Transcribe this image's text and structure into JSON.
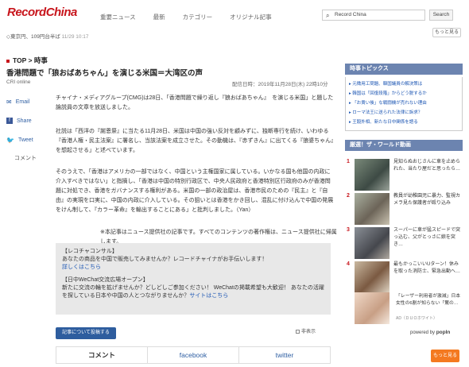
{
  "header": {
    "logo_text": "Record",
    "logo_accent": "China",
    "nav": [
      "重要ニュース",
      "最新",
      "カテゴリー",
      "オリジナル記事"
    ],
    "search_placeholder": "Record China",
    "search_button": "Search",
    "motto_button": "もっと見る"
  },
  "ticker": {
    "text": "◇東京円、109円台半ば",
    "time": "11/29 10:17"
  },
  "breadcrumb": "TOP > 時事",
  "article": {
    "title": "香港問題で「狼おばあちゃん」を演じる米国＝大湾区の声",
    "source": "CRI online",
    "date": "配信日時：2019年11月28日(木) 22時10分",
    "paragraphs": [
      "チャイナ・メディアグループ(CMG)は28日、「香港問題で繰り返し『狼おばあちゃん』　を演じる米国」と題した論説員の文章を放送しました。",
      "社説は「西洋の『謝恩祭』に当たる11月28日、米国は中国の強い反対を顧みずに、独断専行を続け、いわゆる『香港人権・民主法案』に署名し、当該法案を成立させた。その動機は、『赤ずきん』に出てくる『狼婆ちゃん』を想起させる」と述べています。",
      "そのうえで、「香港はアメリカの一部ではなく、中国という主権国家に属している。いかなる国も他国の内政に介入すべきではない」と指摘し、「香港は中国の特別行政区で、中央人民政府と香港特別区行政府のみが香港問題に対処でき、香港をガバナンスする権利がある。米国の一部の政治屋は、香港市民のための『民主』と『自由』の実現を口実に、中国の内政に介入している。その狙いとは香港をかき回し、混乱に付け込んで中国の発展をけん制して、『カラー革命』を輸出することにある」と批判しました。（Yan）"
    ],
    "note": "※本記事はニュース提供社の記事です。すべてのコンテンツの著作権は、ニュース提供社に帰属します。"
  },
  "share": {
    "email": "Email",
    "share": "Share",
    "tweet": "Tweet",
    "comment": "コメント"
  },
  "promo": {
    "h1": "【レコチャコンサル】",
    "l1": "あなたの商品を中国で販売してみませんか？レコードチャイナがお手伝いします！",
    "link1": "詳しくはこちら",
    "h2": "【日中WeChat交流広場オープン】",
    "l2": "新たに交流の輪を拡げませんか？どしどしご参加ください！ WeChatの掲載希望も大歓迎！ あなたの活躍を探している日本や中国の人とつながりませんか？",
    "link2": "サイトはこちら"
  },
  "controls": {
    "article_button": "記事について投稿する",
    "checkbox_label": "非表示"
  },
  "tabs": [
    "コメント",
    "facebook",
    "twitter"
  ],
  "sidebar": {
    "topics_title": "時事トピックス",
    "topics": [
      "元徴用工問題、韓国議員の解決策は",
      "韓国は「回復段階」からどう脱するか",
      "「お貴い後」な戦闘機が売れない理由",
      "ローマ法王に送られた法律に訴求？",
      "王毅外相、新たな日中関係を語る"
    ],
    "ranking_title": "厳選！ザ・ワールド動画",
    "ranking": [
      {
        "num": "1",
        "text": "見知らぬおじさんに車を止められた、当たり屋だと思ったら…"
      },
      {
        "num": "2",
        "text": "教員が幼稚園児に暴力、監視カメラ見た保護者が殴り込み"
      },
      {
        "num": "3",
        "text": "スーパーに車が猛スピードで突っ込む、父がとっさに娘を突き…"
      },
      {
        "num": "4",
        "text": "最もかっこいいUターン！休みを取った消防士、緊急出動へ…"
      }
    ],
    "ad_text": "「レーザー利用者が激減」日本女性の6割が知らない「驚の…",
    "ad_label": "AD（ＤＵＯホワイト）",
    "powered": "powered by",
    "popin": "popIn",
    "more": "もっと見る"
  }
}
